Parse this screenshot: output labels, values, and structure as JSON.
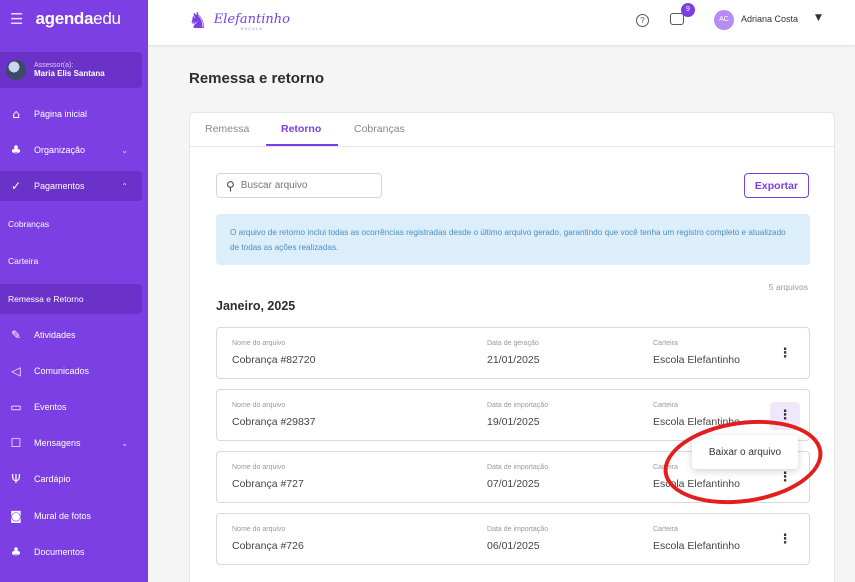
{
  "brand": {
    "logo_bold": "agenda",
    "logo_thin": "edu"
  },
  "assessor": {
    "label": "Assessor(a):",
    "name": "Maria Elis Santana"
  },
  "sidebar": {
    "items": [
      {
        "label": "Página inicial",
        "icon": "home-icon"
      },
      {
        "label": "Organização",
        "icon": "org-icon",
        "has_chevron": true
      },
      {
        "label": "Pagamentos",
        "icon": "check-icon",
        "expanded": true
      },
      {
        "label": "Cobranças",
        "sub": true
      },
      {
        "label": "Carteira",
        "sub": true
      },
      {
        "label": "Remessa e Retorno",
        "sub": true,
        "active": true
      },
      {
        "label": "Atividades",
        "icon": "pencil-icon"
      },
      {
        "label": "Comunicados",
        "icon": "megaphone-icon"
      },
      {
        "label": "Eventos",
        "icon": "calendar-icon"
      },
      {
        "label": "Mensagens",
        "icon": "chat-icon",
        "has_chevron": true
      },
      {
        "label": "Cardápio",
        "icon": "utensils-icon"
      },
      {
        "label": "Mural de fotos",
        "icon": "camera-icon"
      },
      {
        "label": "Documentos",
        "icon": "org-icon"
      }
    ]
  },
  "topbar": {
    "school_name": "Elefantinho",
    "school_sub": "ESCOLA",
    "notification_count": "9",
    "user_initials": "AC",
    "user_name": "Adriana Costa"
  },
  "page": {
    "title": "Remessa e retorno"
  },
  "tabs": [
    {
      "label": "Remessa"
    },
    {
      "label": "Retorno",
      "active": true
    },
    {
      "label": "Cobranças"
    }
  ],
  "search": {
    "placeholder": "Buscar arquivo"
  },
  "export_label": "Exportar",
  "info_text": "O arquivo de retorno inclui todas as ocorrências registradas desde o último arquivo gerado, garantindo que você tenha um registro completo e atualizado de todas as ações realizadas.",
  "file_count": "5 arquivos",
  "month_label": "Janeiro, 2025",
  "column_labels": {
    "name": "Nome do arquivo",
    "wallet": "Carteira"
  },
  "rows": [
    {
      "name": "Cobrança #82720",
      "date_label": "Data de geração",
      "date": "21/01/2025",
      "wallet": "Escola Elefantinho"
    },
    {
      "name": "Cobrança #29837",
      "date_label": "Data de importação",
      "date": "19/01/2025",
      "wallet": "Escola Elefantinho"
    },
    {
      "name": "Cobrança #727",
      "date_label": "Data de importação",
      "date": "07/01/2025",
      "wallet": "Escola Elefantinho"
    },
    {
      "name": "Cobrança #726",
      "date_label": "Data de importação",
      "date": "06/01/2025",
      "wallet": "Escola Elefantinho"
    }
  ],
  "context_menu": {
    "item": "Baixar o arquivo"
  },
  "colors": {
    "accent": "#7b3fe4",
    "info_bg": "#dbeefa",
    "highlight_ring": "#e31e1e"
  }
}
